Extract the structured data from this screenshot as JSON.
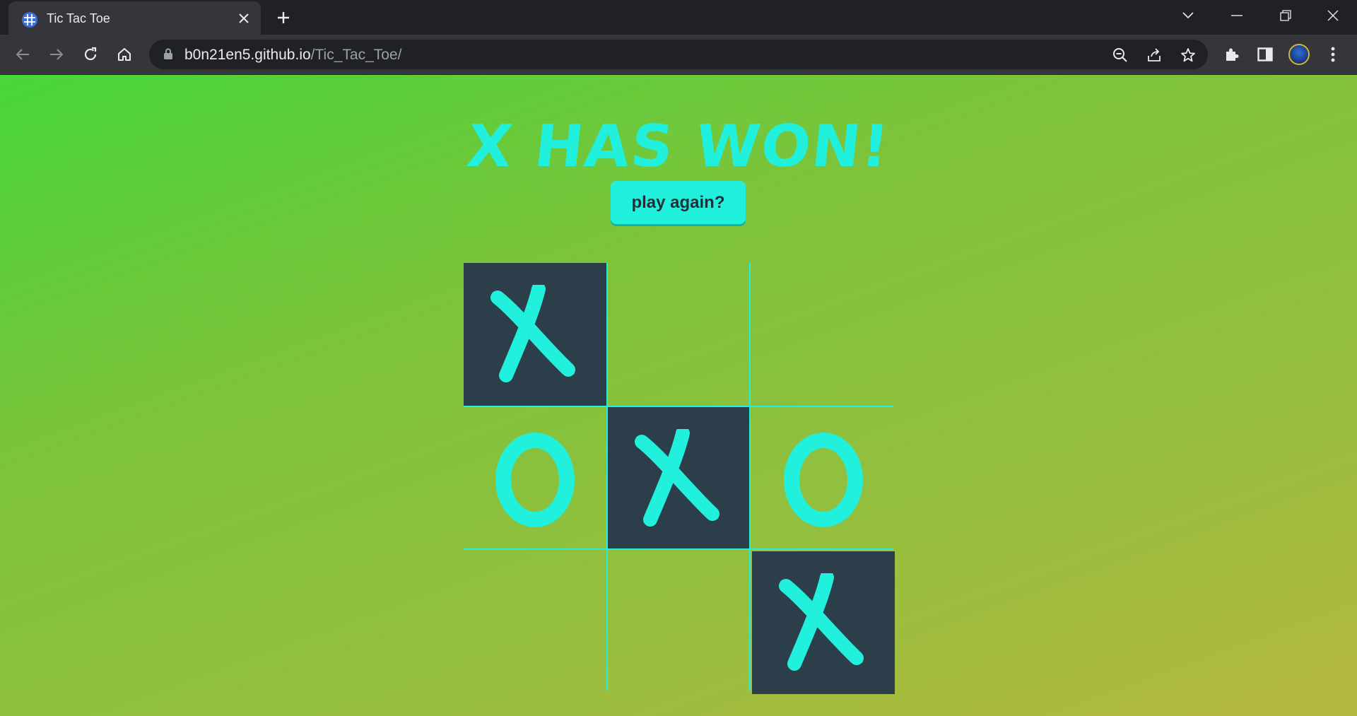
{
  "browser": {
    "tab": {
      "title": "Tic Tac Toe",
      "favicon": "grid-favicon-icon"
    },
    "url": {
      "host": "b0n21en5.github.io",
      "path": "/Tic_Tac_Toe/"
    },
    "colors": {
      "chrome_dark": "#202124",
      "chrome_mid": "#35363a",
      "text": "#e8eaed"
    }
  },
  "game": {
    "status": "X has won!",
    "play_again_label": "play again?",
    "board": [
      [
        "X",
        "",
        ""
      ],
      [
        "O",
        "X",
        "O"
      ],
      [
        "",
        "",
        "X"
      ]
    ],
    "colors": {
      "accent": "#21f0dc",
      "winning_cell": "#2c3e4a",
      "bg_start": "#47d63a",
      "bg_end": "#b5b83e"
    }
  }
}
